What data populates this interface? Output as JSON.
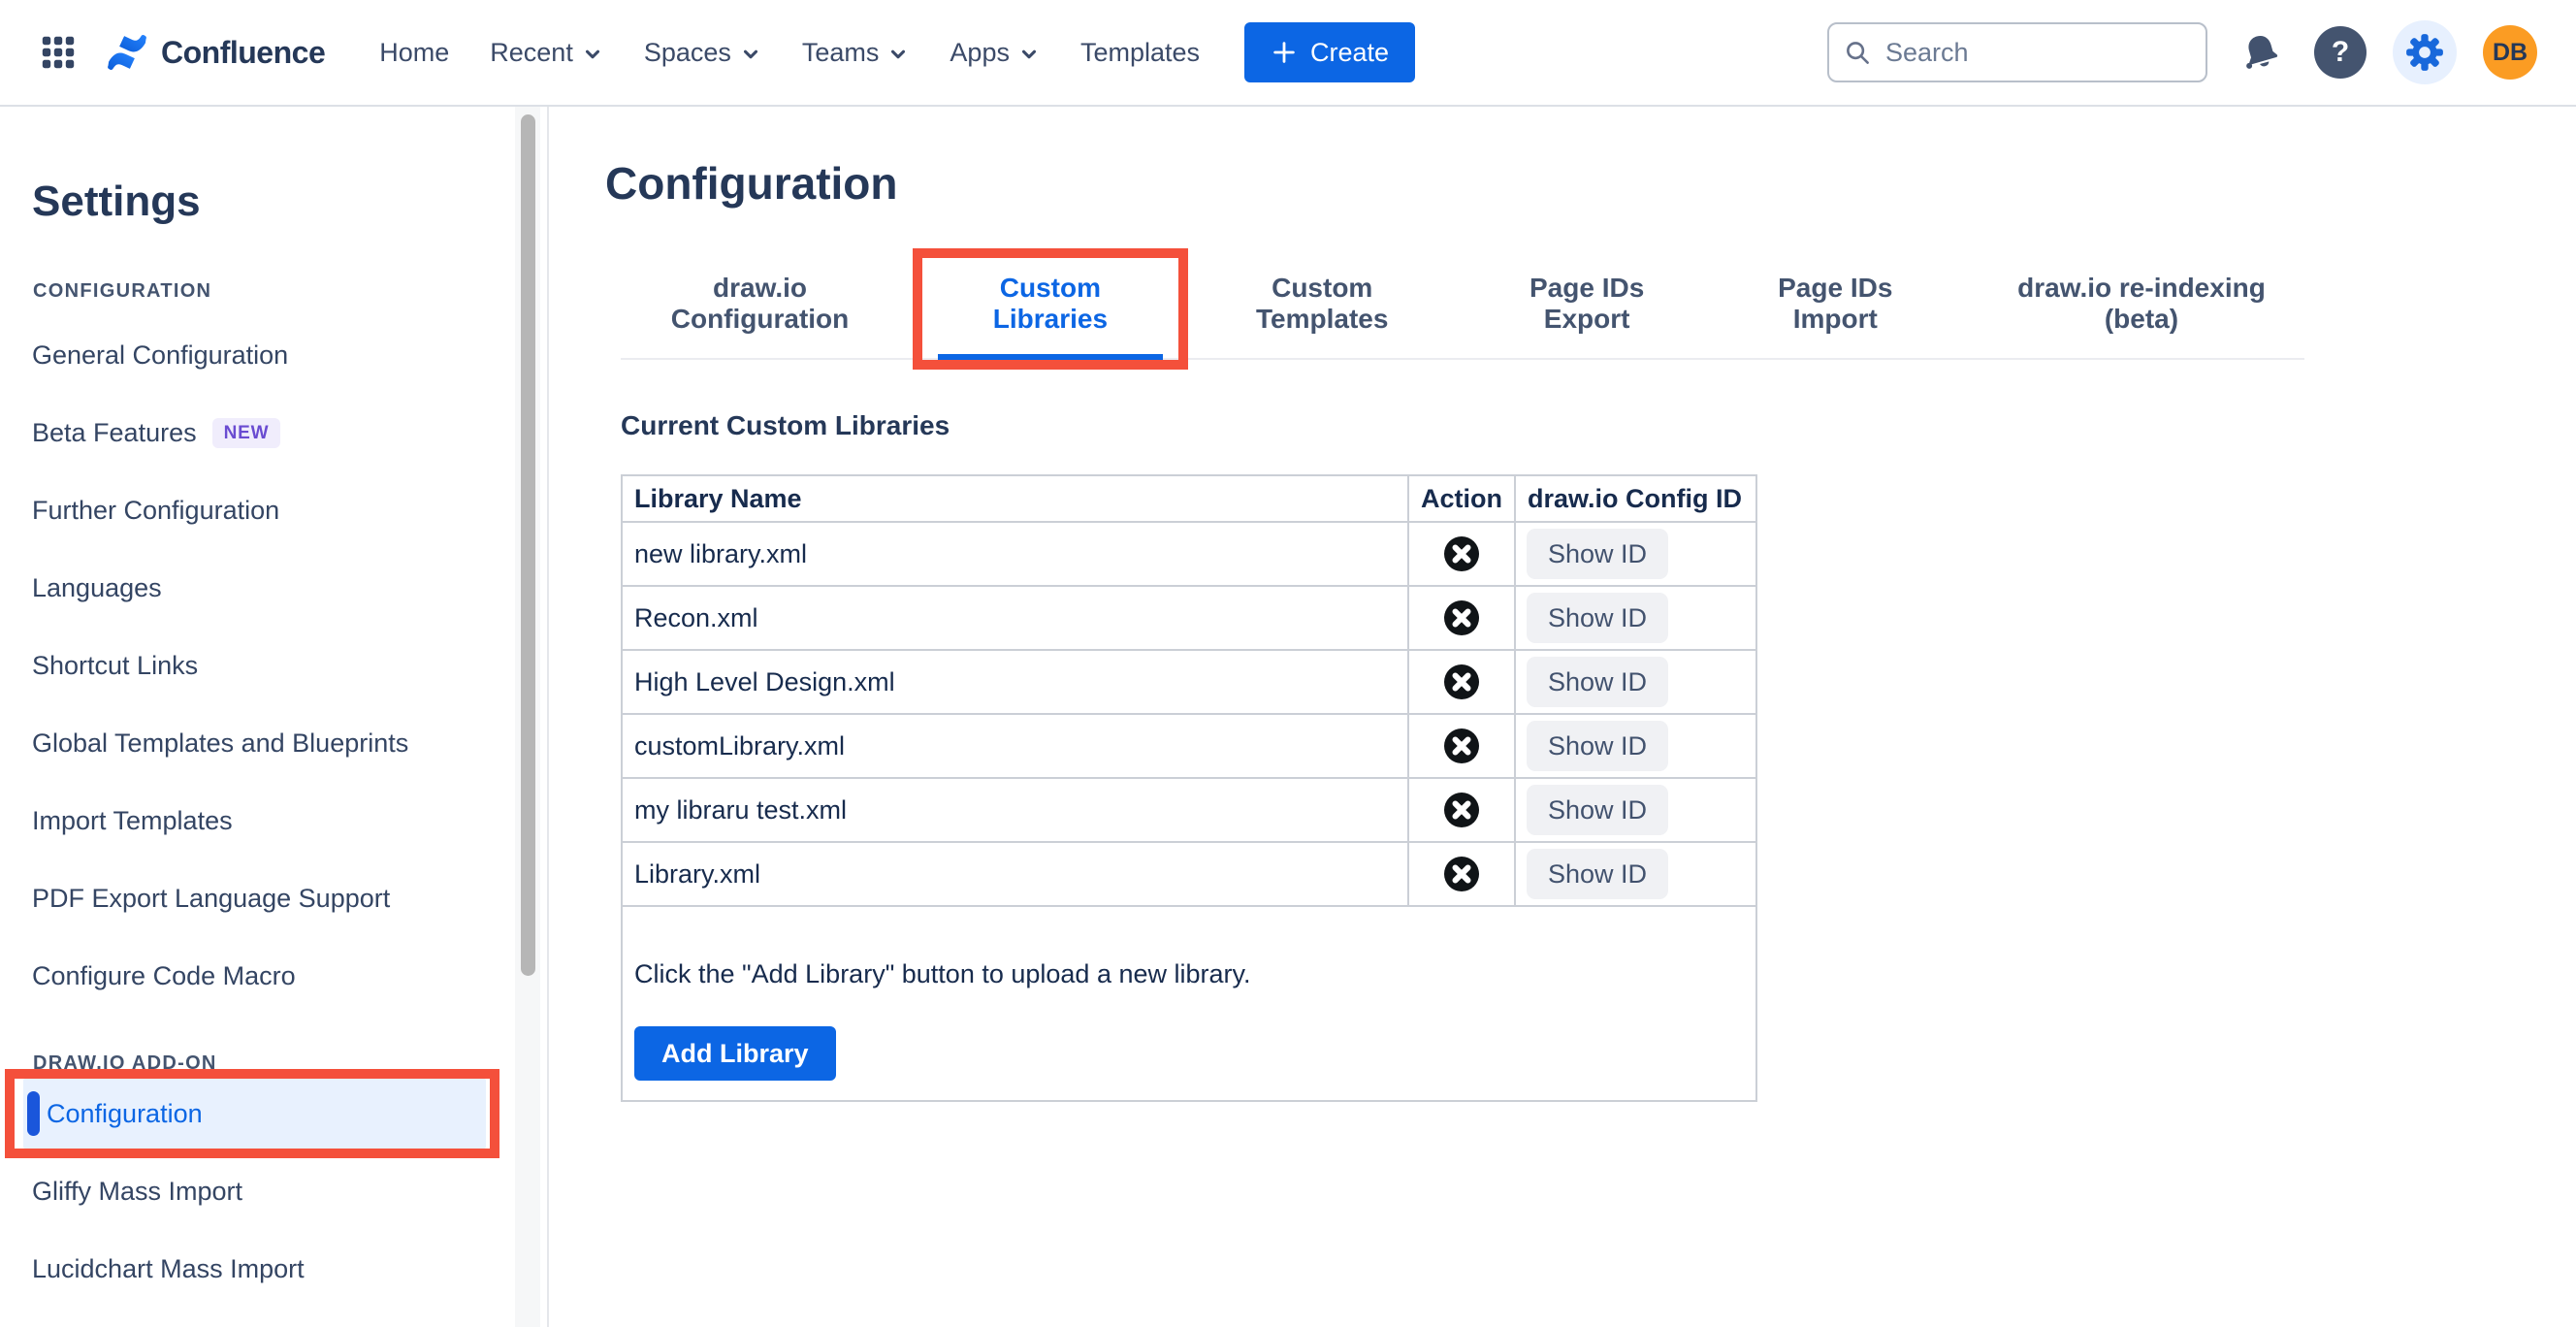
{
  "colors": {
    "accent_blue": "#0C66E4",
    "annotation_red": "#F4503B",
    "selected_item_bg": "#E8F1FE",
    "selected_indicator_blue": "#1A56DB",
    "badge_bg": "#F0EDFC",
    "badge_text": "#6A4CD1",
    "avatar_bg": "#FB9C23",
    "icon_dark": "#44546F",
    "gear_blue": "#1868DB",
    "gear_circle_bg": "#E7F0FE",
    "heading_navy": "#253858",
    "table_text": "#172B4D"
  },
  "topbar": {
    "app_switcher_icon": "grid-3x3",
    "logo_icon": "confluence-mark",
    "logo_text": "Confluence",
    "nav": [
      {
        "label": "Home",
        "has_dropdown": false
      },
      {
        "label": "Recent",
        "has_dropdown": true
      },
      {
        "label": "Spaces",
        "has_dropdown": true
      },
      {
        "label": "Teams",
        "has_dropdown": true
      },
      {
        "label": "Apps",
        "has_dropdown": true
      },
      {
        "label": "Templates",
        "has_dropdown": false
      }
    ],
    "create_label": "Create",
    "search": {
      "placeholder": "Search",
      "value": "",
      "icon": "magnifier"
    },
    "icons": [
      "bell-icon",
      "help-icon",
      "gear-icon"
    ],
    "help_glyph": "?",
    "avatar_initials": "DB"
  },
  "sidebar": {
    "title": "Settings",
    "sections": [
      {
        "label": "CONFIGURATION",
        "items": [
          {
            "label": "General Configuration"
          },
          {
            "label": "Beta Features",
            "badge": "NEW"
          },
          {
            "label": "Further Configuration"
          },
          {
            "label": "Languages"
          },
          {
            "label": "Shortcut Links"
          },
          {
            "label": "Global Templates and Blueprints"
          },
          {
            "label": "Import Templates"
          },
          {
            "label": "PDF Export Language Support"
          },
          {
            "label": "Configure Code Macro"
          }
        ]
      },
      {
        "label": "DRAW.IO ADD-ON",
        "items": [
          {
            "label": "Configuration",
            "selected": true,
            "annotated": true
          },
          {
            "label": "Gliffy Mass Import"
          },
          {
            "label": "Lucidchart Mass Import"
          }
        ]
      }
    ]
  },
  "main": {
    "title": "Configuration",
    "tabs": [
      {
        "label": "draw.io Configuration",
        "active": false
      },
      {
        "label": "Custom Libraries",
        "active": true,
        "annotated": true
      },
      {
        "label": "Custom Templates",
        "active": false
      },
      {
        "label": "Page IDs Export",
        "active": false
      },
      {
        "label": "Page IDs Import",
        "active": false
      },
      {
        "label": "draw.io re-indexing (beta)",
        "active": false
      }
    ],
    "section_heading": "Current Custom Libraries",
    "table": {
      "columns": [
        "Library Name",
        "Action",
        "draw.io Config ID"
      ],
      "rows": [
        {
          "name": "new library.xml",
          "action": "delete",
          "config_button": "Show ID"
        },
        {
          "name": "Recon.xml",
          "action": "delete",
          "config_button": "Show ID"
        },
        {
          "name": "High Level Design.xml",
          "action": "delete",
          "config_button": "Show ID"
        },
        {
          "name": "customLibrary.xml",
          "action": "delete",
          "config_button": "Show ID"
        },
        {
          "name": "my libraru test.xml",
          "action": "delete",
          "config_button": "Show ID"
        },
        {
          "name": "Library.xml",
          "action": "delete",
          "config_button": "Show ID"
        }
      ],
      "footer_text": "Click the \"Add Library\" button to upload a new library.",
      "add_button": "Add Library"
    }
  }
}
